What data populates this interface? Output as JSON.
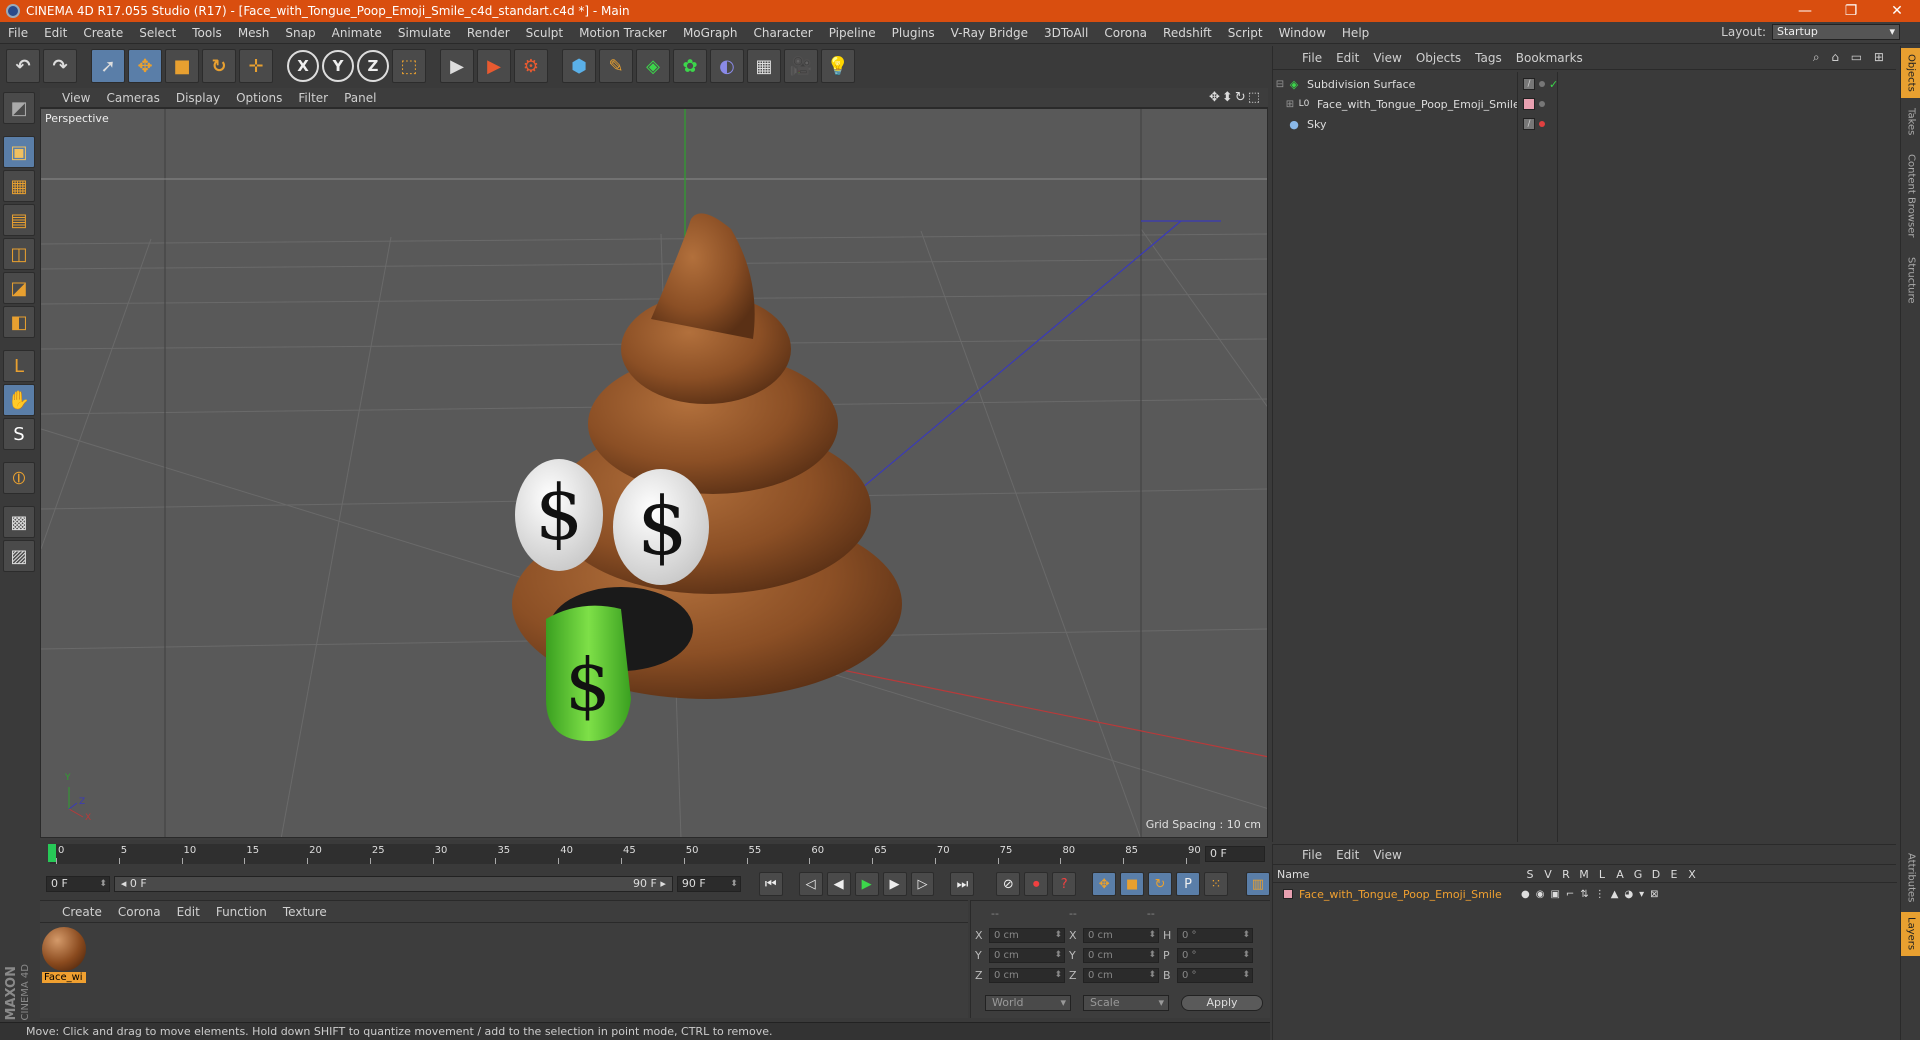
{
  "window": {
    "title": "CINEMA 4D R17.055 Studio (R17) - [Face_with_Tongue_Poop_Emoji_Smile_c4d_standart.c4d *] - Main",
    "minimize": "—",
    "restore": "❐",
    "close": "✕"
  },
  "menubar": {
    "items": [
      "File",
      "Edit",
      "Create",
      "Select",
      "Tools",
      "Mesh",
      "Snap",
      "Animate",
      "Simulate",
      "Render",
      "Sculpt",
      "Motion Tracker",
      "MoGraph",
      "Character",
      "Pipeline",
      "Plugins",
      "V-Ray Bridge",
      "3DToAll",
      "Corona",
      "Redshift",
      "Script",
      "Window",
      "Help"
    ],
    "layout_label": "Layout:",
    "layout_value": "Startup"
  },
  "toolbar": {
    "undo": "↶",
    "redo": "↷",
    "select": "➚",
    "move": "✥",
    "scale": "■",
    "rotate": "↻",
    "last_tool": "✛",
    "axis_x": "X",
    "axis_y": "Y",
    "axis_z": "Z",
    "coord_system": "⬚",
    "render_view": "▶",
    "render_picture": "▶",
    "render_settings": "⚙",
    "cube": "⬢",
    "pen": "✎",
    "subdivision": "◈",
    "cloner": "✿",
    "deformer": "◐",
    "floor": "▦",
    "camera": "🎥",
    "light": "💡"
  },
  "lefttools": {
    "make_editable": "◩",
    "model": "▣",
    "texture": "▦",
    "workplane": "▤",
    "points": "◫",
    "edges": "◪",
    "polygons": "◧",
    "axis": "L",
    "tweak": "✋",
    "snap": "S",
    "magnet": "⦶",
    "locked_workplane": "▩",
    "planar_workplane": "▨"
  },
  "viewport": {
    "menu": [
      "View",
      "Cameras",
      "Display",
      "Options",
      "Filter",
      "Panel"
    ],
    "nav_icons": "✥⬍↻⬚",
    "label": "Perspective",
    "grid_spacing": "Grid Spacing : 10 cm",
    "axis_y": "Y",
    "axis_x": "X",
    "axis_z": "Z",
    "dollar": "$"
  },
  "timeline": {
    "ticks": [
      "0",
      "5",
      "10",
      "15",
      "20",
      "25",
      "30",
      "35",
      "40",
      "45",
      "50",
      "55",
      "60",
      "65",
      "70",
      "75",
      "80",
      "85",
      "90"
    ],
    "end_frame": "0 F",
    "current_frame": "0 F",
    "range_start": "◂ 0 F",
    "range_end": "90 F ▸",
    "max_frame": "90 F"
  },
  "transport": {
    "first": "⏮",
    "prev_key": "◁",
    "prev": "◀",
    "play": "▶",
    "next": "▶",
    "next_key": "▷",
    "last": "⏭",
    "record_motion": "⊘",
    "autokey": "⏺",
    "key_help": "?",
    "key_move": "✥",
    "key_scale": "■",
    "key_rotate": "↻",
    "key_param": "P",
    "key_pla": "⁙",
    "timeline_btn": "▥"
  },
  "material_manager": {
    "menu": [
      "Create",
      "Corona",
      "Edit",
      "Function",
      "Texture"
    ],
    "material_name": "Face_wi"
  },
  "coordinates": {
    "header": [
      "--",
      "--",
      "--"
    ],
    "rows": [
      {
        "l1": "X",
        "v1": "0 cm",
        "l2": "X",
        "v2": "0 cm",
        "l3": "H",
        "v3": "0 °"
      },
      {
        "l1": "Y",
        "v1": "0 cm",
        "l2": "Y",
        "v2": "0 cm",
        "l3": "P",
        "v3": "0 °"
      },
      {
        "l1": "Z",
        "v1": "0 cm",
        "l2": "Z",
        "v2": "0 cm",
        "l3": "B",
        "v3": "0 °"
      }
    ],
    "mode": "World",
    "size_mode": "Scale",
    "apply": "Apply"
  },
  "statusbar": {
    "text": "Move: Click and drag to move elements. Hold down SHIFT to quantize movement / add to the selection in point mode, CTRL to remove."
  },
  "maxon": {
    "line1": "MAXON",
    "line2": "CINEMA 4D"
  },
  "object_manager": {
    "menu": [
      "File",
      "Edit",
      "View",
      "Objects",
      "Tags",
      "Bookmarks"
    ],
    "icons": "⌕ ⌂ ▭ ⊞",
    "objects": [
      {
        "name": "Subdivision Surface",
        "tree": "⊟",
        "icon": "◈",
        "icon_color": "#3cd64b"
      },
      {
        "name": "Face_with_Tongue_Poop_Emoji_Smile",
        "tree": "⊞",
        "icon": "L0",
        "icon_color": "#dddddd"
      },
      {
        "name": "Sky",
        "tree": "",
        "icon": "●",
        "icon_color": "#8ab8e8"
      }
    ]
  },
  "vertical_tabs": [
    "Objects",
    "Takes",
    "Content Browser",
    "Structure",
    "Attributes",
    "Layers"
  ],
  "layer_manager": {
    "menu": [
      "File",
      "Edit",
      "View"
    ],
    "columns": [
      "Name",
      "S",
      "V",
      "R",
      "M",
      "L",
      "A",
      "G",
      "D",
      "E",
      "X"
    ],
    "layer_name": "Face_with_Tongue_Poop_Emoji_Smile",
    "layer_icons": [
      "●",
      "◉",
      "▣",
      "⌐",
      "⇅",
      "⋮",
      "▲",
      "◕",
      "▾",
      "⊠"
    ]
  }
}
